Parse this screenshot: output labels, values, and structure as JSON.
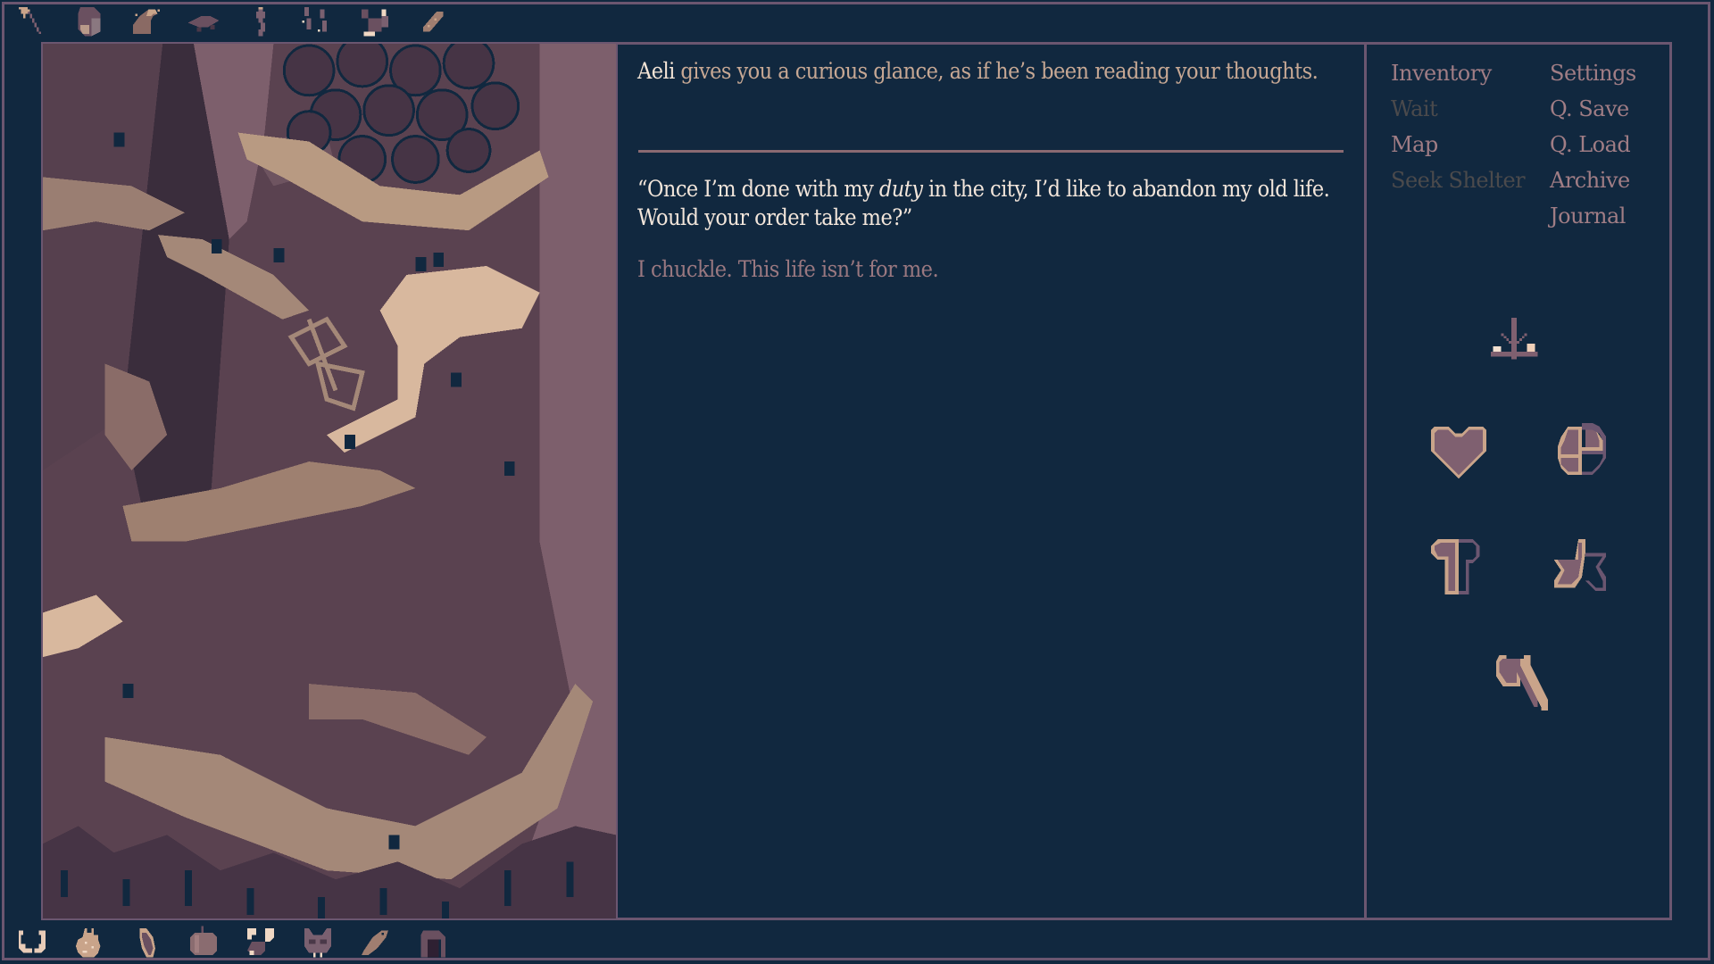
{
  "top_icon_bar": [
    {
      "name": "axe-icon"
    },
    {
      "name": "crate-icon"
    },
    {
      "name": "wave-icon"
    },
    {
      "name": "plank-icon"
    },
    {
      "name": "figurine-icon"
    },
    {
      "name": "footprints-icon"
    },
    {
      "name": "squirrel-icon"
    },
    {
      "name": "bread-icon"
    }
  ],
  "bottom_icon_bar": [
    {
      "name": "horns-icon"
    },
    {
      "name": "fire-icon"
    },
    {
      "name": "seed-icon"
    },
    {
      "name": "apple-icon"
    },
    {
      "name": "bat-icon"
    },
    {
      "name": "wolf-mask-icon"
    },
    {
      "name": "fish-icon"
    },
    {
      "name": "helmet-icon"
    }
  ],
  "story": {
    "speaker": "Aeli",
    "narration_rest": " gives you a curious glance, as if he’s been reading your thoughts.",
    "dialogue_before": "“Once I’m done with my ",
    "dialogue_emphasis": "duty",
    "dialogue_after": " in the city, I’d like to abandon my old life. Would your order take me?”",
    "choices": [
      {
        "label": "I chuckle. This life isn’t for me."
      }
    ]
  },
  "menu": {
    "left": [
      {
        "label": "Inventory",
        "enabled": true
      },
      {
        "label": "Wait",
        "enabled": false
      },
      {
        "label": "Map",
        "enabled": true
      },
      {
        "label": "Seek Shelter",
        "enabled": false
      }
    ],
    "right": [
      {
        "label": "Settings",
        "enabled": true
      },
      {
        "label": "Q. Save",
        "enabled": true
      },
      {
        "label": "Q. Load",
        "enabled": true
      },
      {
        "label": "Archive",
        "enabled": true
      },
      {
        "label": "Journal",
        "enabled": true
      }
    ]
  },
  "stats": {
    "balance": {
      "icon": "scales-icon"
    },
    "health": {
      "icon": "heart-icon",
      "fill": 1.0
    },
    "nourishment": {
      "icon": "food-icon",
      "fill": 0.75
    },
    "clothing": {
      "icon": "shirt-icon",
      "fill": 0.5
    },
    "reputation": {
      "icon": "star-icon",
      "fill": 0.5
    },
    "tool": {
      "icon": "axe-icon"
    }
  },
  "colors": {
    "background": "#11283f",
    "frame": "#6b5670",
    "text_narration": "#c7a894",
    "text_speaker": "#f3e4d6",
    "text_dialogue": "#f3e6db",
    "text_choice": "#9a7880",
    "menu_enabled": "#a07d85",
    "menu_disabled": "#4b4a4c",
    "icon_fill": "#7f6070",
    "icon_outline": "#c9a48a"
  }
}
